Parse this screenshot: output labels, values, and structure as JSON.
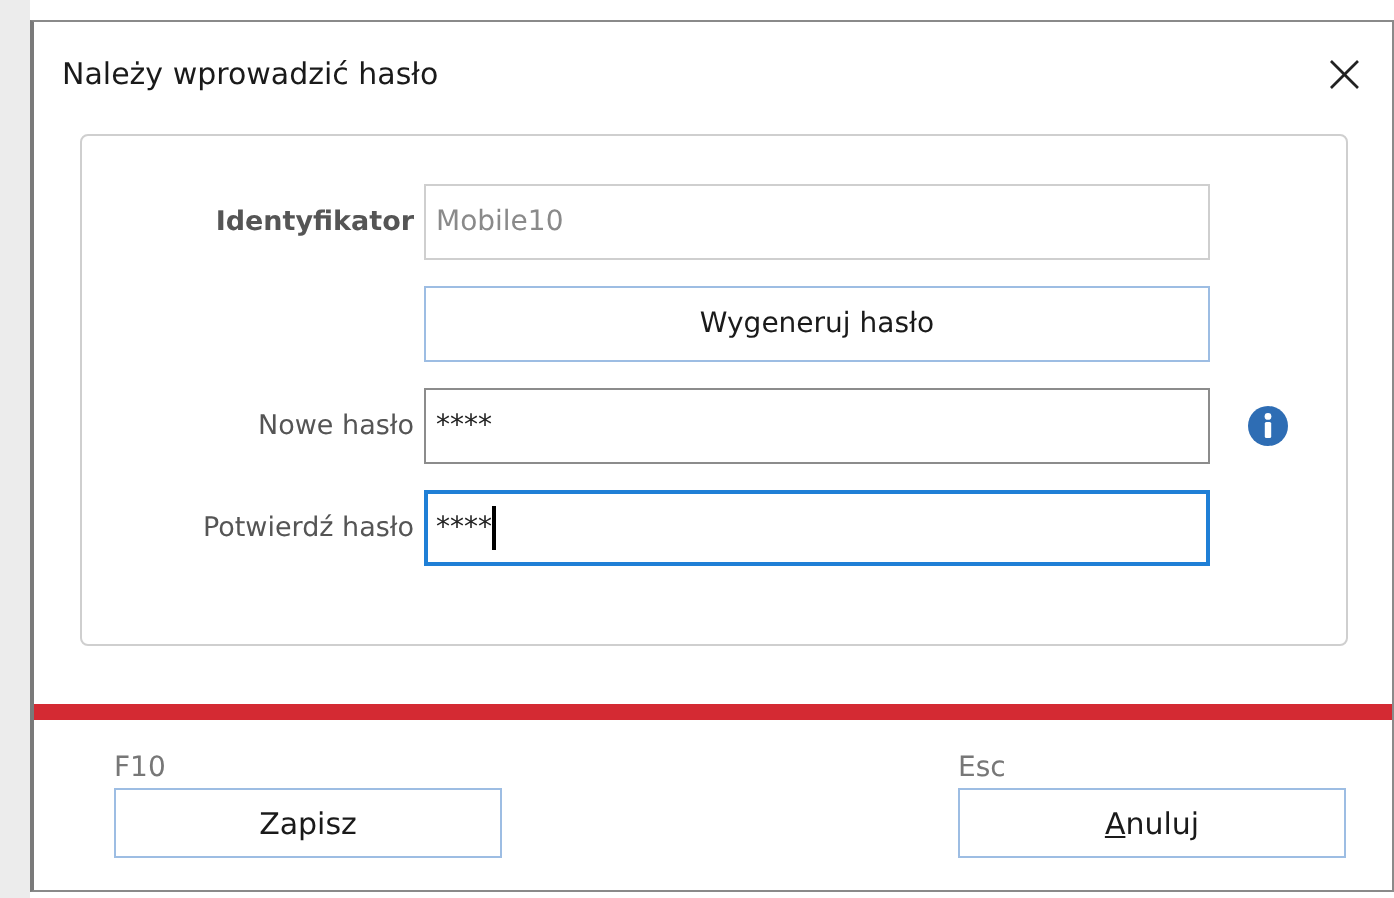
{
  "window": {
    "title": "Należy wprowadzić hasło",
    "close": "×"
  },
  "fields": [
    {
      "kind": "input",
      "label": "Identyfikator",
      "value": "Mobile10",
      "disabled": true,
      "focused": false,
      "info": false
    },
    {
      "kind": "button",
      "label": "Wygeneruj hasło"
    },
    {
      "kind": "input",
      "label": "Nowe hasło",
      "value": "****",
      "disabled": false,
      "focused": false,
      "info": true
    },
    {
      "kind": "input",
      "label": "Potwierdź hasło",
      "value": "****",
      "disabled": false,
      "focused": true,
      "info": false
    }
  ],
  "buttons": [
    {
      "shortcut": "F10",
      "label": "Zapisz",
      "underline_first": false
    },
    {
      "shortcut": "Esc",
      "label": "Anuluj",
      "underline_first": true
    }
  ]
}
